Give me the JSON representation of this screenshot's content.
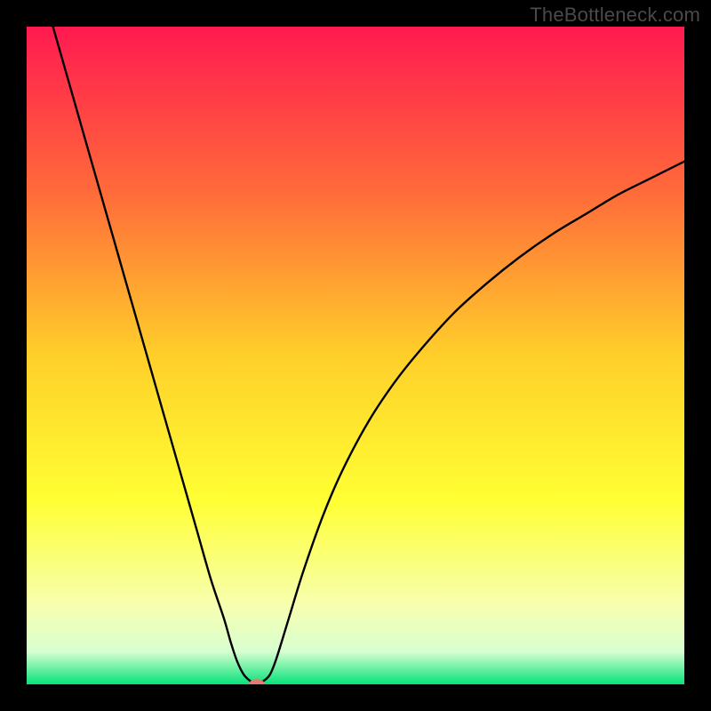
{
  "watermark": "TheBottleneck.com",
  "chart_data": {
    "type": "line",
    "title": "",
    "xlabel": "",
    "ylabel": "",
    "xlim": [
      0,
      100
    ],
    "ylim": [
      0,
      100
    ],
    "grid": false,
    "legend": false,
    "background_gradient": {
      "stops": [
        {
          "pos": 0.0,
          "color": "#ff1a50"
        },
        {
          "pos": 0.25,
          "color": "#ff6a3a"
        },
        {
          "pos": 0.5,
          "color": "#ffcf2a"
        },
        {
          "pos": 0.72,
          "color": "#ffff33"
        },
        {
          "pos": 0.88,
          "color": "#f7ffb0"
        },
        {
          "pos": 0.95,
          "color": "#d8ffd0"
        },
        {
          "pos": 1.0,
          "color": "#06e27a"
        }
      ]
    },
    "series": [
      {
        "name": "curve",
        "color": "#000000",
        "points": [
          {
            "x": 4.0,
            "y": 100.0
          },
          {
            "x": 6.0,
            "y": 93.0
          },
          {
            "x": 8.0,
            "y": 86.0
          },
          {
            "x": 10.0,
            "y": 79.0
          },
          {
            "x": 12.0,
            "y": 72.0
          },
          {
            "x": 14.0,
            "y": 65.0
          },
          {
            "x": 16.0,
            "y": 58.0
          },
          {
            "x": 18.0,
            "y": 51.0
          },
          {
            "x": 20.0,
            "y": 44.0
          },
          {
            "x": 22.0,
            "y": 37.0
          },
          {
            "x": 24.0,
            "y": 30.0
          },
          {
            "x": 26.0,
            "y": 23.0
          },
          {
            "x": 28.0,
            "y": 16.0
          },
          {
            "x": 30.0,
            "y": 10.0
          },
          {
            "x": 31.0,
            "y": 6.5
          },
          {
            "x": 32.0,
            "y": 3.5
          },
          {
            "x": 33.0,
            "y": 1.5
          },
          {
            "x": 34.0,
            "y": 0.5
          },
          {
            "x": 35.0,
            "y": 0.0
          },
          {
            "x": 36.0,
            "y": 0.5
          },
          {
            "x": 37.0,
            "y": 1.5
          },
          {
            "x": 38.0,
            "y": 4.0
          },
          {
            "x": 40.0,
            "y": 10.5
          },
          {
            "x": 42.0,
            "y": 17.0
          },
          {
            "x": 45.0,
            "y": 25.5
          },
          {
            "x": 48.0,
            "y": 32.5
          },
          {
            "x": 52.0,
            "y": 40.0
          },
          {
            "x": 56.0,
            "y": 46.0
          },
          {
            "x": 60.0,
            "y": 51.0
          },
          {
            "x": 65.0,
            "y": 56.5
          },
          {
            "x": 70.0,
            "y": 61.0
          },
          {
            "x": 75.0,
            "y": 65.0
          },
          {
            "x": 80.0,
            "y": 68.5
          },
          {
            "x": 85.0,
            "y": 71.5
          },
          {
            "x": 90.0,
            "y": 74.5
          },
          {
            "x": 95.0,
            "y": 77.0
          },
          {
            "x": 100.0,
            "y": 79.5
          }
        ]
      }
    ],
    "marker": {
      "x": 35.0,
      "y": 0.0,
      "color": "#e8786f",
      "rx": 1.2,
      "ry": 0.8
    }
  }
}
